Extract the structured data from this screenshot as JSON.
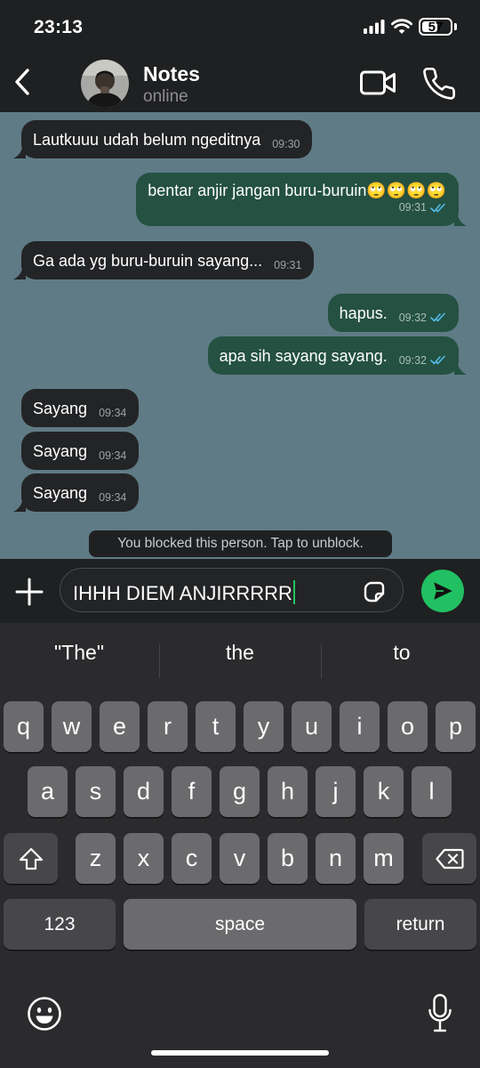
{
  "status_bar": {
    "time": "23:13",
    "battery_level": "57",
    "battery_fraction": 0.57
  },
  "header": {
    "back_icon": "chevron-left-icon",
    "contact_name": "Notes",
    "contact_status": "online",
    "video_icon": "video-camera-icon",
    "call_icon": "phone-icon"
  },
  "messages": [
    {
      "dir": "in",
      "text": "Lautkuuu udah belum ngeditnya",
      "time": "09:30",
      "read": false
    },
    {
      "dir": "out",
      "text": "bentar anjir jangan buru-buruin🙄🙄🙄🙄",
      "time": "09:31",
      "read": true
    },
    {
      "dir": "in",
      "text": "Ga ada yg buru-buruin sayang...",
      "time": "09:31",
      "read": false
    },
    {
      "dir": "out",
      "text": "hapus.",
      "time": "09:32",
      "read": true
    },
    {
      "dir": "out",
      "text": "apa sih sayang sayang.",
      "time": "09:32",
      "read": true
    },
    {
      "dir": "in",
      "text": "Sayang",
      "time": "09:34",
      "read": false
    },
    {
      "dir": "in",
      "text": "Sayang",
      "time": "09:34",
      "read": false
    },
    {
      "dir": "in",
      "text": "Sayang",
      "time": "09:34",
      "read": false
    }
  ],
  "blocked_notice": "You blocked this person. Tap to unblock.",
  "composer": {
    "input_value": "IHHH DIEM ANJIRRRRR",
    "plus_icon": "plus-icon",
    "sticker_icon": "sticker-icon",
    "send_icon": "send-icon"
  },
  "keyboard": {
    "suggestions": [
      "\"The\"",
      "the",
      "to"
    ],
    "row1": [
      "q",
      "w",
      "e",
      "r",
      "t",
      "y",
      "u",
      "i",
      "o",
      "p"
    ],
    "row2": [
      "a",
      "s",
      "d",
      "f",
      "g",
      "h",
      "j",
      "k",
      "l"
    ],
    "row3": [
      "z",
      "x",
      "c",
      "v",
      "b",
      "n",
      "m"
    ],
    "numbers_label": "123",
    "space_label": "space",
    "return_label": "return",
    "shift_icon": "shift-icon",
    "delete_icon": "backspace-icon",
    "emoji_icon": "emoji-icon",
    "mic_icon": "microphone-icon"
  },
  "colors": {
    "chat_background": "#5f7b86",
    "incoming_bubble": "#232426",
    "outgoing_bubble": "#245141",
    "read_ticks": "#53bdeb",
    "send_button": "#21c063",
    "cursor": "#22c35e"
  }
}
